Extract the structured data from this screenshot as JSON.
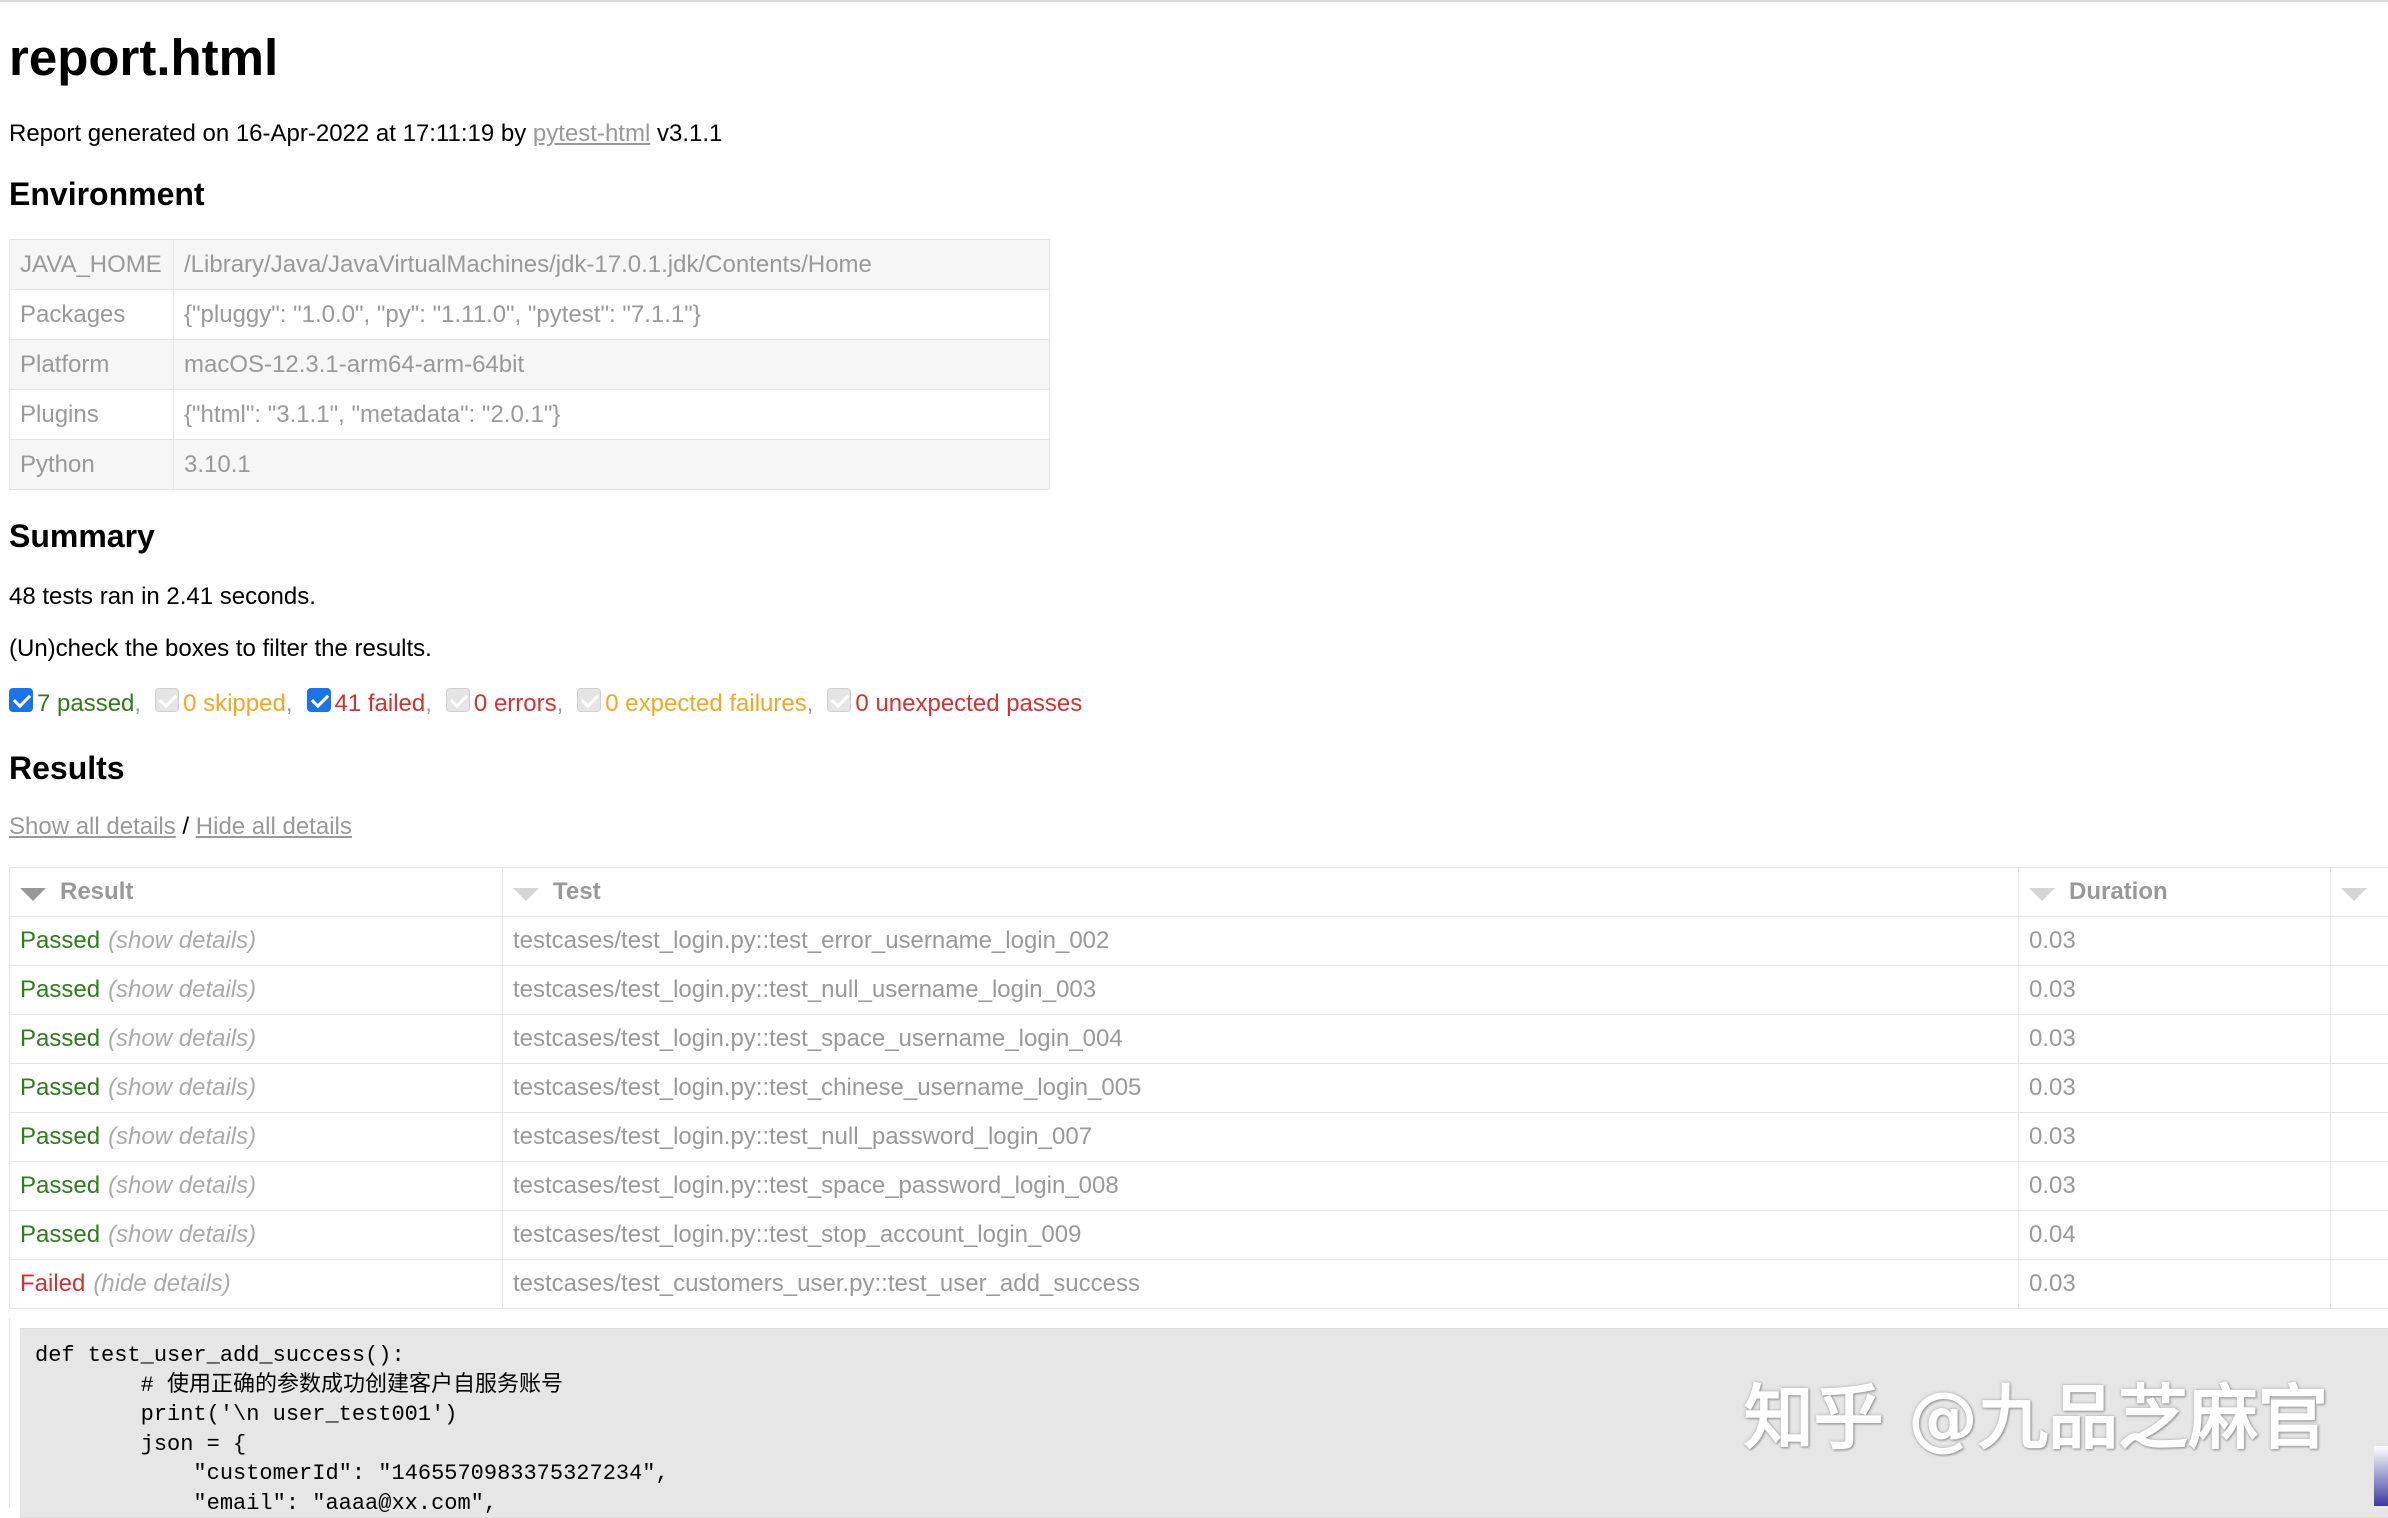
{
  "page": {
    "title": "report.html",
    "generated_prefix": "Report generated on 16-Apr-2022 at 17:11:19 by ",
    "generator_link": "pytest-html",
    "generator_version": " v3.1.1"
  },
  "environment": {
    "heading": "Environment",
    "rows": [
      {
        "key": "JAVA_HOME",
        "value": "/Library/Java/JavaVirtualMachines/jdk-17.0.1.jdk/Contents/Home"
      },
      {
        "key": "Packages",
        "value": "{\"pluggy\": \"1.0.0\", \"py\": \"1.11.0\", \"pytest\": \"7.1.1\"}"
      },
      {
        "key": "Platform",
        "value": "macOS-12.3.1-arm64-arm-64bit"
      },
      {
        "key": "Plugins",
        "value": "{\"html\": \"3.1.1\", \"metadata\": \"2.0.1\"}"
      },
      {
        "key": "Python",
        "value": "3.10.1"
      }
    ]
  },
  "summary": {
    "heading": "Summary",
    "ran": "48 tests ran in 2.41 seconds.",
    "instruction": "(Un)check the boxes to filter the results.",
    "filters": {
      "passed": {
        "label": "7 passed",
        "checked": true
      },
      "skipped": {
        "label": "0 skipped",
        "checked": false
      },
      "failed": {
        "label": "41 failed",
        "checked": true
      },
      "errors": {
        "label": "0 errors",
        "checked": false
      },
      "xfailed": {
        "label": "0 expected failures",
        "checked": false
      },
      "xpassed": {
        "label": "0 unexpected passes",
        "checked": false
      }
    },
    "separator": ","
  },
  "results": {
    "heading": "Results",
    "show_all": "Show all details",
    "slash": " / ",
    "hide_all": "Hide all details",
    "columns": {
      "result": "Result",
      "test": "Test",
      "duration": "Duration"
    },
    "rows": [
      {
        "status": "Passed",
        "toggle": "(show details)",
        "test": "testcases/test_login.py::test_error_username_login_002",
        "duration": "0.03"
      },
      {
        "status": "Passed",
        "toggle": "(show details)",
        "test": "testcases/test_login.py::test_null_username_login_003",
        "duration": "0.03"
      },
      {
        "status": "Passed",
        "toggle": "(show details)",
        "test": "testcases/test_login.py::test_space_username_login_004",
        "duration": "0.03"
      },
      {
        "status": "Passed",
        "toggle": "(show details)",
        "test": "testcases/test_login.py::test_chinese_username_login_005",
        "duration": "0.03"
      },
      {
        "status": "Passed",
        "toggle": "(show details)",
        "test": "testcases/test_login.py::test_null_password_login_007",
        "duration": "0.03"
      },
      {
        "status": "Passed",
        "toggle": "(show details)",
        "test": "testcases/test_login.py::test_space_password_login_008",
        "duration": "0.03"
      },
      {
        "status": "Passed",
        "toggle": "(show details)",
        "test": "testcases/test_login.py::test_stop_account_login_009",
        "duration": "0.04"
      },
      {
        "status": "Failed",
        "toggle": "(hide details)",
        "test": "testcases/test_customers_user.py::test_user_add_success",
        "duration": "0.03"
      }
    ],
    "code_lines": [
      "def test_user_add_success():",
      "        # 使用正确的参数成功创建客户自服务账号",
      "        print('\\n user_test001')",
      "        json = {",
      "            \"customerId\": \"1465570983375327234\",",
      "            \"email\": \"aaaa@xx.com\","
    ]
  },
  "watermark": "知乎 @九品芝麻官"
}
